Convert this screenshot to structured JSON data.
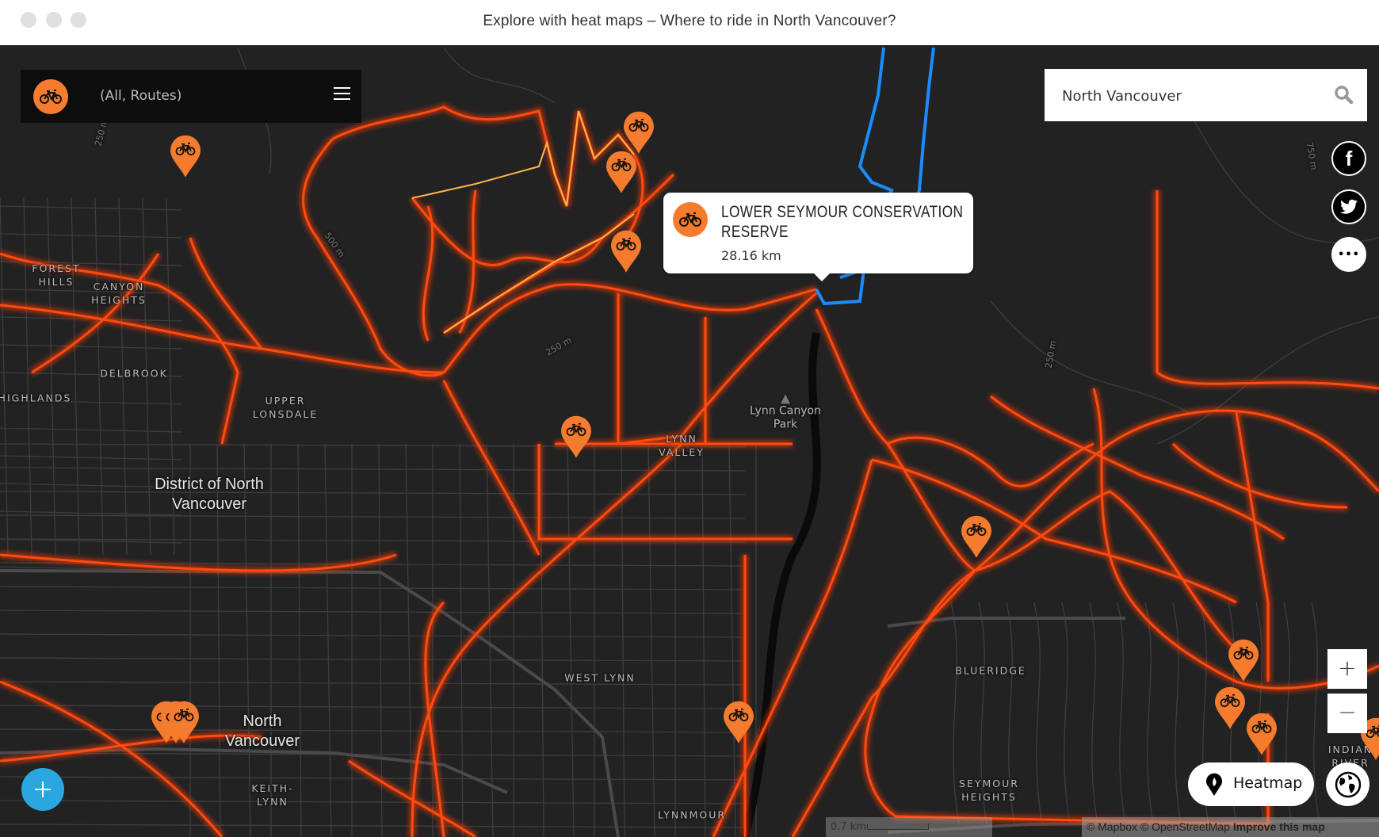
{
  "window": {
    "title": "Explore with heat maps – Where to ride in North Vancouver?"
  },
  "filter_panel": {
    "label": "(All, Routes)",
    "icon": "bike-icon",
    "menu_icon": "hamburger-icon"
  },
  "search": {
    "value": "North Vancouver",
    "icon": "search-icon"
  },
  "social": [
    {
      "name": "facebook-icon",
      "glyph": "f"
    },
    {
      "name": "twitter-icon"
    },
    {
      "name": "more-icon",
      "glyph": "•••"
    }
  ],
  "popup": {
    "title_line1": "LOWER SEYMOUR CONSERVATION",
    "title_line2": "RESERVE",
    "distance": "28.16 km"
  },
  "zoom": {
    "in": "+",
    "out": "−"
  },
  "heatmap_button": {
    "label": "Heatmap"
  },
  "scale": {
    "label": "0.7 km"
  },
  "attribution": {
    "mapbox": "© Mapbox",
    "osm": "© OpenStreetMap",
    "improve": "Improve this map"
  },
  "map_labels": {
    "forest_hills": [
      "FOREST",
      "HILLS"
    ],
    "canyon_heights": [
      "CANYON",
      "HEIGHTS"
    ],
    "delbrook": "DELBROOK",
    "highlands": "HIGHLANDS",
    "upper_lonsdale": [
      "UPPER",
      "LONSDALE"
    ],
    "district": [
      "District of North",
      "Vancouver"
    ],
    "lynn_valley": [
      "LYNN",
      "VALLEY"
    ],
    "lynn_canyon_park": [
      "Lynn Canyon",
      "Park"
    ],
    "west_lynn": "WEST LYNN",
    "north_vancouver": [
      "North",
      "Vancouver"
    ],
    "blueridge": "BLUERIDGE",
    "seymour_heights": [
      "SEYMOUR",
      "HEIGHTS"
    ],
    "keith_lynn": [
      "KEITH-",
      "LYNN"
    ],
    "lynnmour": "LYNNMOUR",
    "indian_river": [
      "INDIAN",
      "RIVER"
    ],
    "contour_250_left": "250 m",
    "contour_500": "500 m",
    "contour_250_mid": "250 m",
    "contour_250_right": "250 m",
    "contour_750": "750 m"
  },
  "colors": {
    "accent": "#f57c2e",
    "heat": "#ff4a10",
    "heat_core": "#ffb347",
    "river_route": "#1a8cff",
    "map_bg": "#222223",
    "add_button": "#29a8e0"
  }
}
